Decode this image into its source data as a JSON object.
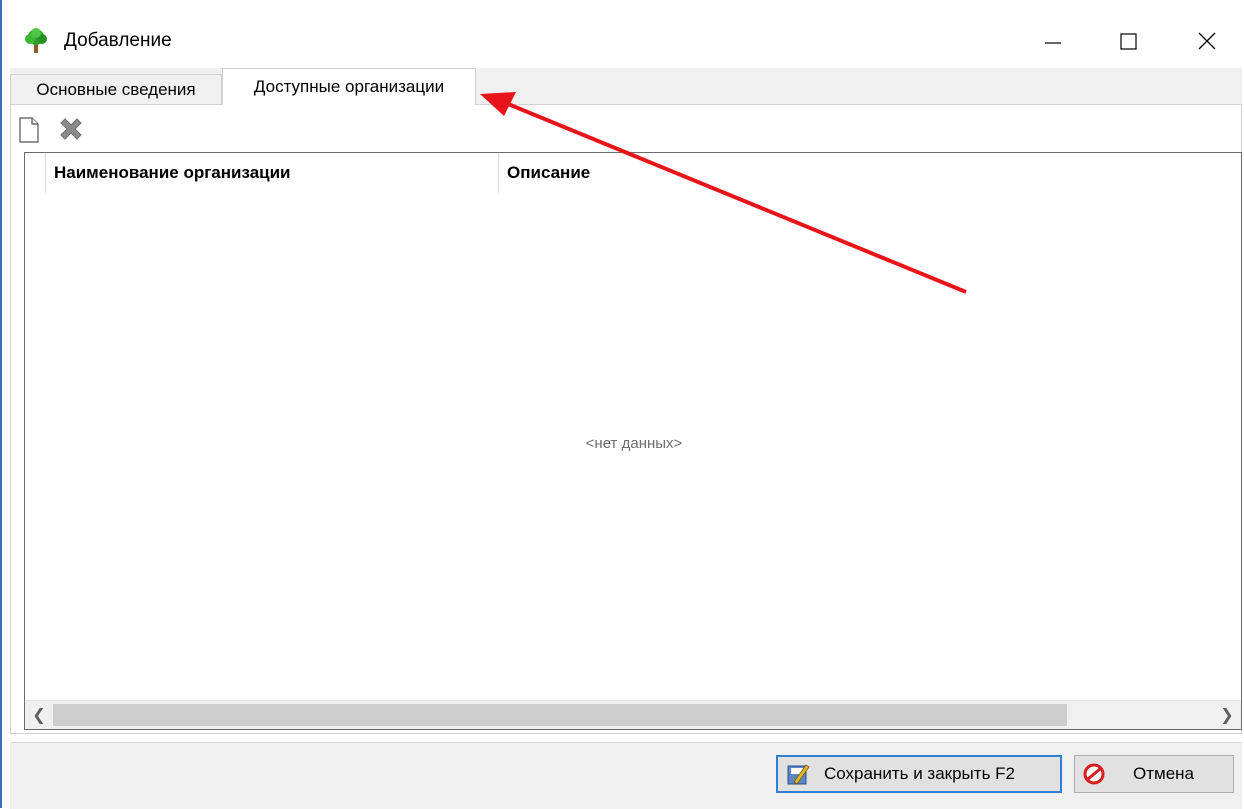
{
  "window": {
    "title": "Добавление",
    "app_icon": "tree-icon"
  },
  "tabs": [
    {
      "label": "Основные сведения",
      "active": false
    },
    {
      "label": "Доступные организации",
      "active": true
    }
  ],
  "toolbar": {
    "new_icon": "new-document-icon",
    "delete_icon": "delete-x-icon"
  },
  "grid": {
    "columns": [
      "Наименование организации",
      "Описание"
    ],
    "empty_text": "<нет данных>"
  },
  "buttons": {
    "save_label": "Сохранить и закрыть F2",
    "cancel_label": "Отмена"
  },
  "colors": {
    "annotation_arrow": "#e8141a",
    "focus_border": "#2f7fd6"
  }
}
